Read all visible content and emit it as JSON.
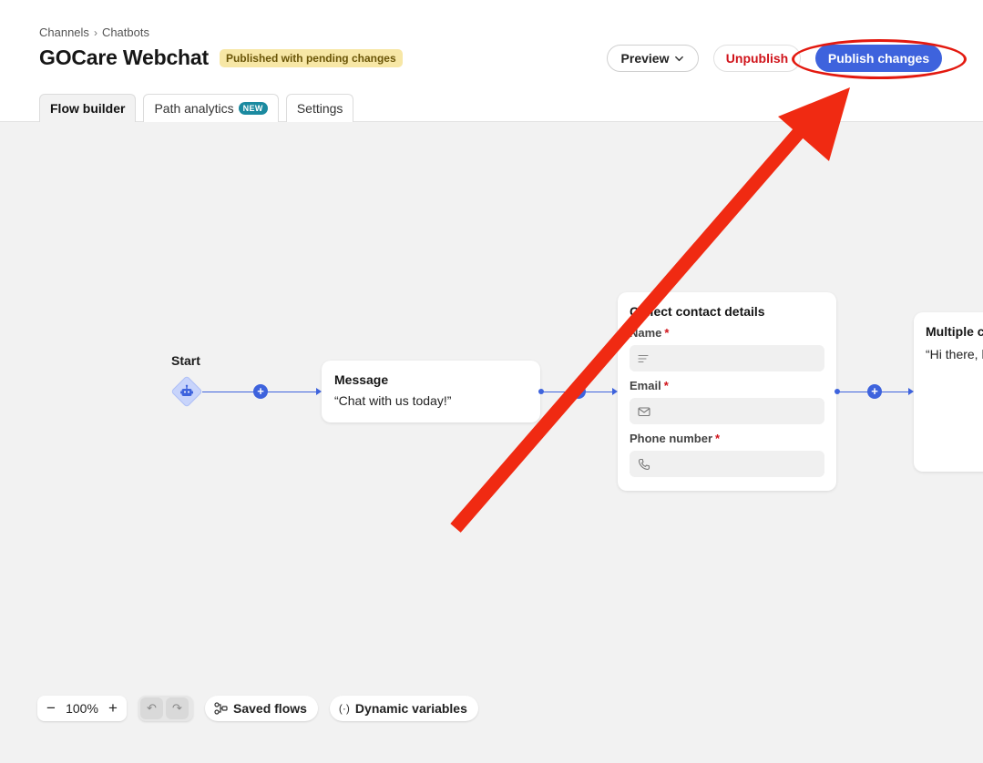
{
  "breadcrumb": {
    "items": [
      "Channels",
      "Chatbots"
    ],
    "separator": "›"
  },
  "header": {
    "title": "GOCare Webchat",
    "status": "Published with pending changes",
    "buttons": {
      "preview": "Preview",
      "unpublish": "Unpublish",
      "publish": "Publish changes"
    }
  },
  "tabs": [
    {
      "label": "Flow builder",
      "active": true
    },
    {
      "label": "Path analytics",
      "badge": "NEW",
      "active": false
    },
    {
      "label": "Settings",
      "active": false
    }
  ],
  "flow": {
    "start_label": "Start",
    "message_card": {
      "title": "Message",
      "text": "“Chat with us today!”"
    },
    "contact_card": {
      "title": "Collect contact details",
      "fields": [
        {
          "label": "Name",
          "required_mark": "*",
          "icon": "text-lines-icon"
        },
        {
          "label": "Email",
          "required_mark": "*",
          "icon": "mail-icon"
        },
        {
          "label": "Phone number",
          "required_mark": "*",
          "icon": "phone-icon"
        }
      ]
    },
    "multi_card": {
      "title": "Multiple choice",
      "text": "“Hi there, how can we help?”"
    },
    "plus_symbol": "+"
  },
  "toolbar": {
    "zoom_out": "−",
    "zoom_level": "100%",
    "zoom_in": "+",
    "undo": "↶",
    "redo": "↷",
    "saved_flows": "Saved flows",
    "dynamic_variables": "Dynamic variables",
    "dynamic_variables_icon": "(·)"
  },
  "colors": {
    "accent": "#3e63dd",
    "danger": "#d0131a",
    "badge_bg": "#f7e7a6",
    "new_badge": "#1b8aa0",
    "annotation": "#e3190f",
    "canvas_bg": "#f2f2f2"
  }
}
